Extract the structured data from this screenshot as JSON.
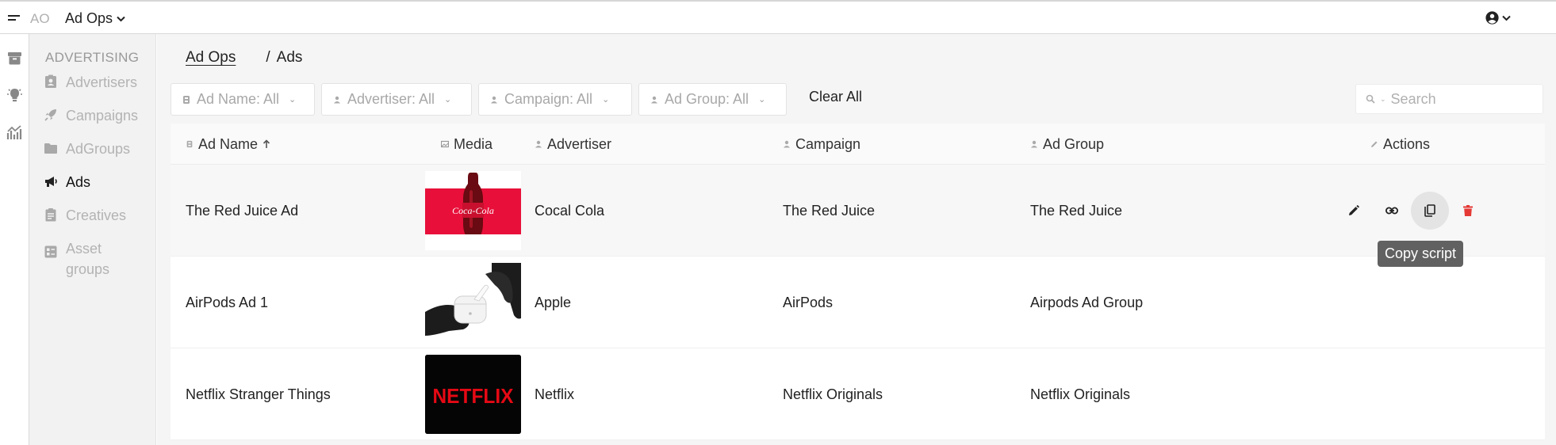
{
  "topbar": {
    "org_abbr": "AO",
    "org_name": "Ad Ops"
  },
  "rail": {
    "icons": [
      "archive-icon",
      "lightbulb-icon",
      "analytics-icon"
    ]
  },
  "sidebar": {
    "section_title": "ADVERTISING",
    "items": [
      {
        "label": "Advertisers",
        "icon": "contact-badge-icon",
        "active": false
      },
      {
        "label": "Campaigns",
        "icon": "rocket-icon",
        "active": false
      },
      {
        "label": "AdGroups",
        "icon": "folder-icon",
        "active": false
      },
      {
        "label": "Ads",
        "icon": "megaphone-icon",
        "active": true
      },
      {
        "label": "Creatives",
        "icon": "clipboard-icon",
        "active": false
      },
      {
        "label": "Asset groups",
        "icon": "asset-group-icon",
        "active": false
      }
    ]
  },
  "breadcrumb": {
    "parent": "Ad Ops",
    "separator": "/",
    "current": "Ads"
  },
  "filters": [
    {
      "label": "Ad Name: All",
      "icon": "ad-icon"
    },
    {
      "label": "Advertiser: All",
      "icon": "person-icon"
    },
    {
      "label": "Campaign: All",
      "icon": "person-icon"
    },
    {
      "label": "Ad Group: All",
      "icon": "person-icon"
    }
  ],
  "clear_all_label": "Clear All",
  "search": {
    "placeholder": "Search",
    "value": ""
  },
  "table": {
    "columns": [
      "Ad Name",
      "Media",
      "Advertiser",
      "Campaign",
      "Ad Group",
      "Actions"
    ],
    "sort": {
      "column": "Ad Name",
      "direction": "ascending"
    },
    "rows": [
      {
        "ad_name": "The Red Juice Ad",
        "media": "coca-cola-bottle-image",
        "advertiser": "Cocal Cola",
        "campaign": "The Red Juice",
        "ad_group": "The Red Juice"
      },
      {
        "ad_name": "AirPods Ad 1",
        "media": "airpods-case-image",
        "advertiser": "Apple",
        "campaign": "AirPods",
        "ad_group": "Airpods Ad Group"
      },
      {
        "ad_name": "Netflix Stranger Things",
        "media": "netflix-logo-image",
        "advertiser": "Netflix",
        "campaign": "Netflix Originals",
        "ad_group": "Netflix Originals"
      }
    ],
    "row_actions": [
      "edit-icon",
      "link-icon",
      "copy-icon",
      "delete-icon"
    ]
  },
  "tooltip": {
    "text": "Copy script"
  },
  "media_text": {
    "coke_logo": "Coca-Cola",
    "netflix_logo": "NETFLIX"
  },
  "colors": {
    "delete": "#e53935",
    "coke_red": "#e8103a",
    "netflix_red": "#e50914",
    "sidebar_bg": "#f2f2f2"
  }
}
